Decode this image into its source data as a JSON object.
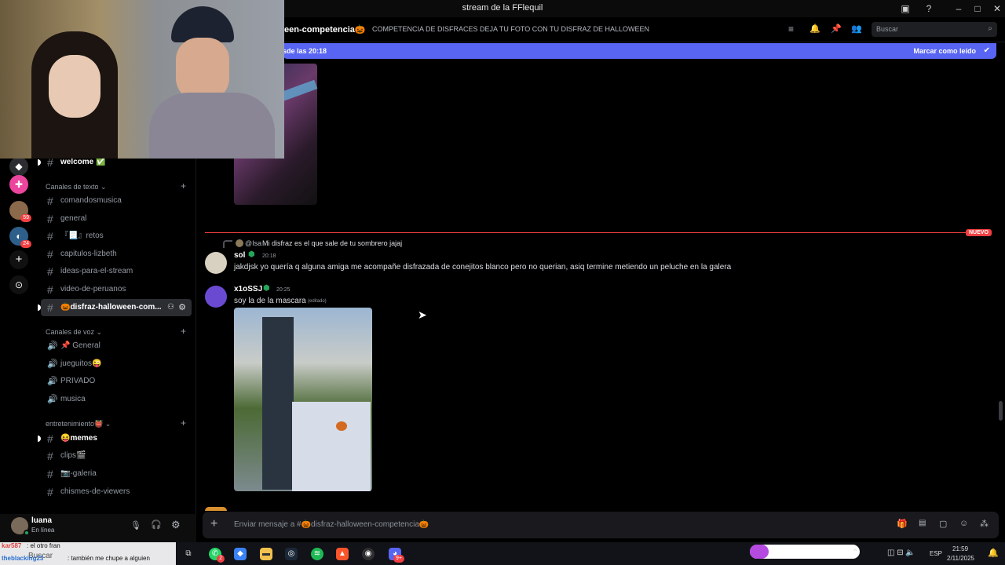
{
  "window": {
    "title": "stream de la FFlequil"
  },
  "header": {
    "channel": "een-competencia🎃",
    "topic": "COMPETENCIA DE DISFRACES DEJA TU FOTO CON TU DISFRAZ DE HALLOWEEN",
    "search_placeholder": "Buscar"
  },
  "banner": {
    "left": "sde las 20:18",
    "right": "Marcar como leído"
  },
  "servers": {
    "badge1": "59",
    "badge2": "24"
  },
  "sidebar": {
    "top_channel": "welcome ✅",
    "cat_text": "Canales de texto",
    "text_channels": [
      "comandosmusica",
      "general",
      "『📃』retos",
      "capitulos-lizbeth",
      "ideas-para-el-stream",
      "video-de-peruanos",
      "🎃disfraz-halloween-com..."
    ],
    "cat_voice": "Canales de voz",
    "voice_channels": [
      "📌 General",
      "jueguitos😜",
      "PRIVADO",
      "musica"
    ],
    "cat_ent": "entretenimiento👹",
    "ent_channels": [
      "😝memes",
      "clips🎬",
      "📷-galeria",
      "chismes-de-viewers"
    ]
  },
  "user": {
    "name": "luana",
    "status": "En línea"
  },
  "messages": {
    "new_label": "NUEVO",
    "reply_author": "@Isa",
    "reply_text": "Mi disfraz es el que sale de tu sombrero jajaj",
    "m1_author": "sol",
    "m1_time": "20:18",
    "m1_text": "jakdjsk yo quería q alguna amiga me acompañe disfrazada de conejitos blanco pero no querian, asiq termine metiendo un peluche en la galera",
    "m2_author": "x1oSSJ",
    "m2_time": "20:25",
    "m2_text": "soy la de la mascara",
    "m2_edited": "(editado)"
  },
  "composer": {
    "placeholder": "Enviar mensaje a #🎃disfraz-halloween-competencia🎃"
  },
  "taskbar": {
    "overlay1": "kar587",
    "overlay2": ": el otro fran",
    "overlay3": "theblacking23",
    "overlay4": ": también me chupe a alguien",
    "search": "Buscar",
    "lang": "ESP",
    "time": "21:59",
    "date": "2/11/2025",
    "wa_badge": "2",
    "discord_badge": "9+"
  },
  "colors": {
    "accent": "#5865f2",
    "red": "#f23f42",
    "green": "#23a55a"
  }
}
